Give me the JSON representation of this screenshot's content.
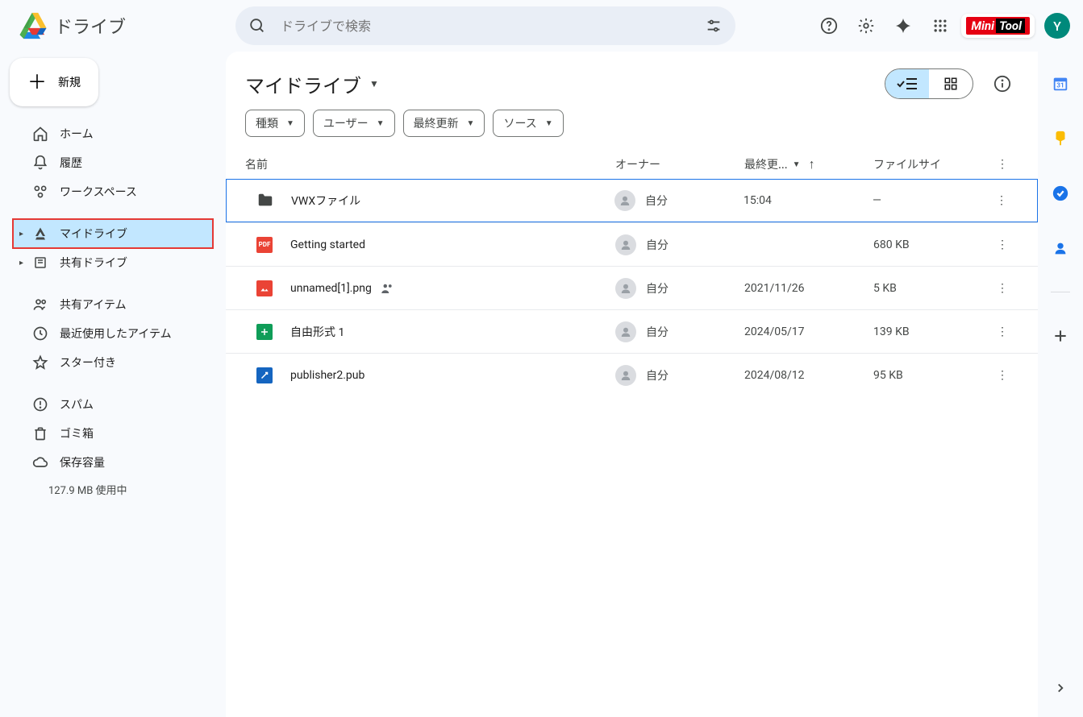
{
  "app": {
    "title": "ドライブ"
  },
  "search": {
    "placeholder": "ドライブで検索"
  },
  "avatar_initial": "Y",
  "extension_name": "MiniTool",
  "new_button": "新規",
  "sidebar": {
    "items": [
      {
        "label": "ホーム"
      },
      {
        "label": "履歴"
      },
      {
        "label": "ワークスペース"
      },
      {
        "label": "マイドライブ"
      },
      {
        "label": "共有ドライブ"
      },
      {
        "label": "共有アイテム"
      },
      {
        "label": "最近使用したアイテム"
      },
      {
        "label": "スター付き"
      },
      {
        "label": "スパム"
      },
      {
        "label": "ゴミ箱"
      },
      {
        "label": "保存容量"
      }
    ],
    "storage_usage": "127.9 MB 使用中"
  },
  "page": {
    "title": "マイドライブ"
  },
  "filters": [
    {
      "label": "種類"
    },
    {
      "label": "ユーザー"
    },
    {
      "label": "最終更新"
    },
    {
      "label": "ソース"
    }
  ],
  "columns": {
    "name": "名前",
    "owner": "オーナー",
    "modified": "最終更...",
    "size": "ファイルサイ"
  },
  "rows": [
    {
      "name": "VWXファイル",
      "owner": "自分",
      "modified": "15:04",
      "size": "—",
      "icon": "folder",
      "shared": false
    },
    {
      "name": "Getting started",
      "owner": "自分",
      "modified": "",
      "size": "680 KB",
      "icon": "pdf",
      "shared": false
    },
    {
      "name": "unnamed[1].png",
      "owner": "自分",
      "modified": "2021/11/26",
      "size": "5 KB",
      "icon": "image",
      "shared": true
    },
    {
      "name": "自由形式 1",
      "owner": "自分",
      "modified": "2024/05/17",
      "size": "139 KB",
      "icon": "sheet",
      "shared": false
    },
    {
      "name": "publisher2.pub",
      "owner": "自分",
      "modified": "2024/08/12",
      "size": "95 KB",
      "icon": "pub",
      "shared": false
    }
  ]
}
